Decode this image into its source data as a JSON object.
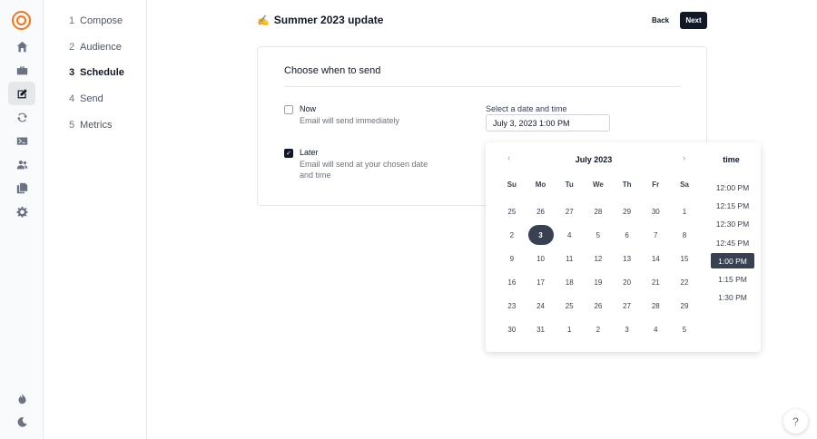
{
  "rail": {
    "icons": [
      "logo-icon",
      "home-icon",
      "briefcase-icon",
      "edit-icon",
      "refresh-icon",
      "terminal-icon",
      "users-icon",
      "documents-icon",
      "settings-icon",
      "flame-icon",
      "moon-icon"
    ],
    "active": "edit-icon"
  },
  "steps": [
    {
      "num": "1",
      "label": "Compose"
    },
    {
      "num": "2",
      "label": "Audience"
    },
    {
      "num": "3",
      "label": "Schedule"
    },
    {
      "num": "4",
      "label": "Send"
    },
    {
      "num": "5",
      "label": "Metrics"
    }
  ],
  "active_step": "3",
  "header": {
    "icon": "✍",
    "title": "Summer 2023 update",
    "back_label": "Back",
    "next_label": "Next"
  },
  "card": {
    "title": "Choose when to send",
    "options": [
      {
        "title": "Now",
        "description": "Email will send immediately",
        "checked": false
      },
      {
        "title": "Later",
        "description": "Email will send at your chosen date and time",
        "checked": true
      }
    ]
  },
  "datetime": {
    "label": "Select a date and time",
    "value": "July 3, 2023 1:00 PM"
  },
  "calendar": {
    "month": "July 2023",
    "prev_icon": "chevron-left-icon",
    "next_icon": "chevron-right-icon",
    "weekdays": [
      "Su",
      "Mo",
      "Tu",
      "We",
      "Th",
      "Fr",
      "Sa"
    ],
    "weeks": [
      [
        "25",
        "26",
        "27",
        "28",
        "29",
        "30",
        "1"
      ],
      [
        "2",
        "3",
        "4",
        "5",
        "6",
        "7",
        "8"
      ],
      [
        "9",
        "10",
        "11",
        "12",
        "13",
        "14",
        "15"
      ],
      [
        "16",
        "17",
        "18",
        "19",
        "20",
        "21",
        "22"
      ],
      [
        "23",
        "24",
        "25",
        "26",
        "27",
        "28",
        "29"
      ],
      [
        "30",
        "31",
        "1",
        "2",
        "3",
        "4",
        "5"
      ]
    ],
    "selected_day": "3"
  },
  "time": {
    "header": "time",
    "options": [
      "12:00 PM",
      "12:15 PM",
      "12:30 PM",
      "12:45 PM",
      "1:00 PM",
      "1:15 PM",
      "1:30 PM"
    ],
    "selected": "1:00 PM"
  },
  "help": {
    "label": "?"
  },
  "colors": {
    "accent": "#f97316",
    "dark": "#111827",
    "selected": "#374151"
  }
}
